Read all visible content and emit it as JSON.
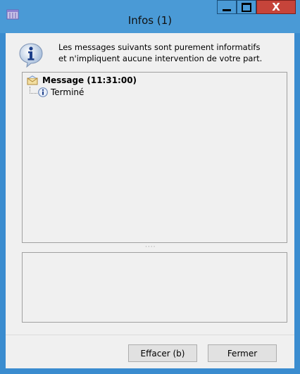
{
  "window": {
    "title": "Infos (1)",
    "accent_color": "#4a9ad6",
    "close_color": "#c6443a",
    "controls": {
      "minimize": "minimize-icon",
      "maximize": "maximize-icon",
      "close": "X"
    }
  },
  "info": {
    "icon": "info-icon",
    "line1": "Les messages suivants sont purement informatifs",
    "line2": "et n'impliquent aucune intervention de votre part."
  },
  "tree": {
    "root": {
      "icon": "envelope-icon",
      "label": "Message (11:31:00)"
    },
    "children": [
      {
        "icon": "info-icon",
        "label": "Terminé"
      }
    ]
  },
  "splitter": "····",
  "buttons": {
    "clear": "Effacer (b)",
    "close": "Fermer"
  }
}
